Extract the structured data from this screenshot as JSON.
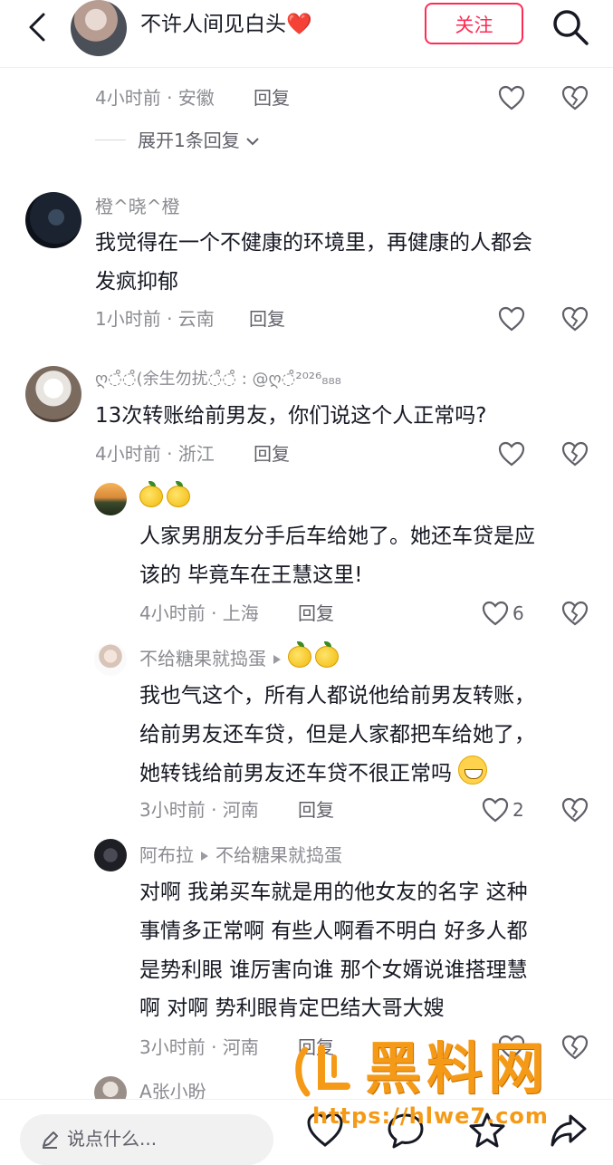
{
  "header": {
    "title": "不许人间见白头❤️",
    "follow_label": "关注"
  },
  "comments": [
    {
      "id": "c0",
      "time": "4小时前 · 安徽",
      "reply": "回复",
      "expand": "展开1条回复"
    },
    {
      "id": "c1",
      "name": "橙^晓^橙",
      "text1": "我觉得在一个不健康的环境里，再健康的人都会",
      "text2": "发疯抑郁",
      "time": "1小时前 · 云南",
      "reply": "回复"
    },
    {
      "id": "c2",
      "name": "ღ◌̊◌̊(余生勿扰◌̊◌̊ : @ღ◌̊²⁰²⁶₈₈₈",
      "text1": "13次转账给前男友，你们说这个人正常吗?",
      "time": "4小时前 · 浙江",
      "reply": "回复"
    },
    {
      "id": "r1",
      "text1": "人家男朋友分手后车给她了。她还车贷是应",
      "text2": "该的 毕竟车在王慧这里!",
      "time": "4小时前 · 上海",
      "reply": "回复",
      "likes": "6"
    },
    {
      "id": "r2",
      "name": "不给糖果就捣蛋",
      "text1": "我也气这个，所有人都说他给前男友转账，",
      "text2": "给前男友还车贷，但是人家都把车给她了，",
      "text3": "她转钱给前男友还车贷不很正常吗",
      "time": "3小时前 · 河南",
      "reply": "回复",
      "likes": "2"
    },
    {
      "id": "r3",
      "name": "阿布拉",
      "reply_to": "不给糖果就捣蛋",
      "text1": "对啊  我弟买车就是用的他女友的名字  这种",
      "text2": "事情多正常啊  有些人啊看不明白  好多人都",
      "text3": "是势利眼 谁厉害向谁  那个女婿说谁搭理慧",
      "text4": "啊 对啊  势利眼肯定巴结大哥大嫂",
      "time": "3小时前 · 河南",
      "reply": "回复"
    },
    {
      "id": "r4",
      "name": "A张小盼"
    }
  ],
  "bottom": {
    "placeholder": "说点什么..."
  },
  "watermark": {
    "text": "黑料网",
    "url": "https://hlwe7.com"
  },
  "colors": {
    "accent": "#fe2c55",
    "text": "#161823",
    "meta": "#8a8b91",
    "watermark": "#f59a16"
  }
}
